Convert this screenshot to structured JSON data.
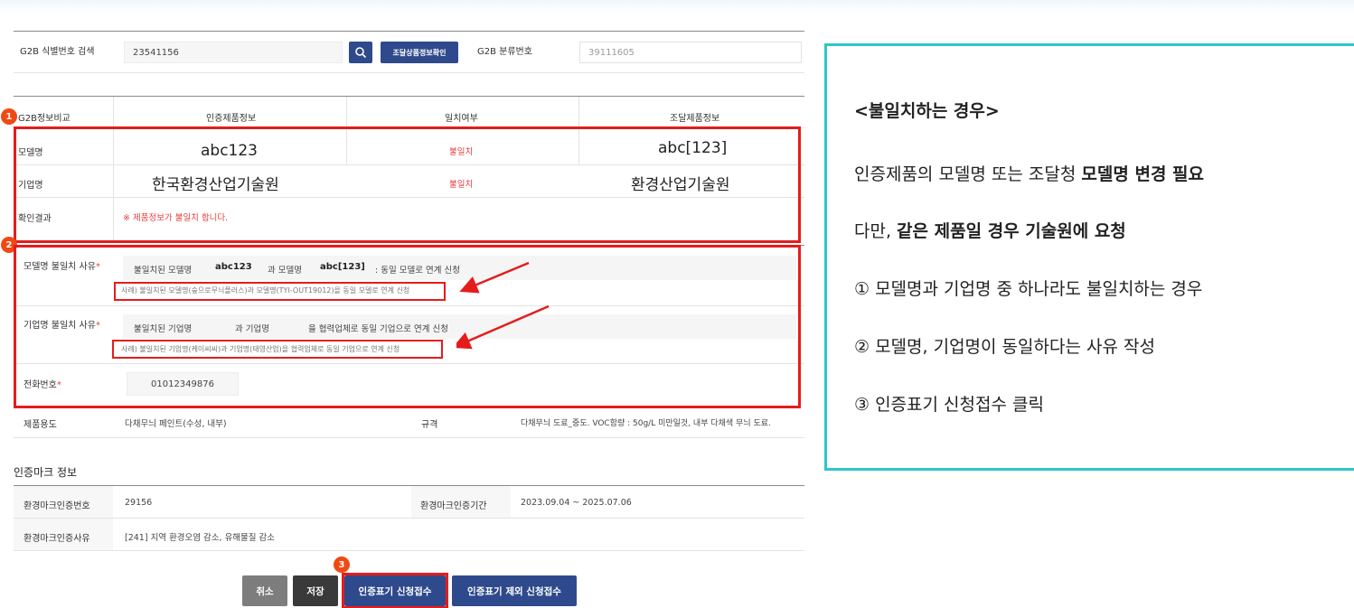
{
  "search": {
    "label": "G2B 식별번호 검색",
    "value": "23541156",
    "confirm_button": "조달상품정보확인",
    "class_label": "G2B 분류번호",
    "class_value": "39111605"
  },
  "compare": {
    "headers": [
      "G2B정보비교",
      "인증제품정보",
      "일치여부",
      "조달제품정보"
    ],
    "rows": [
      {
        "label": "모델명",
        "cert": "abc123",
        "match": "불일치",
        "procure": "abc[123]"
      },
      {
        "label": "기업명",
        "cert": "한국환경산업기술원",
        "match": "불일치",
        "procure": "환경산업기술원"
      }
    ],
    "result_label": "확인결과",
    "result_text": "※ 제품정보가 불일치 합니다."
  },
  "reasons": {
    "model_label": "모델명 불일치 사유",
    "model_prefix": "불일치된 모델명",
    "model_cert": "abc123",
    "model_mid": "과 모델명",
    "model_procure": "abc[123]",
    "model_suffix": ": 동일 모델로 연계 신청",
    "model_hint": "사례) 불일치된 모델명(숲으로무늬플러스)과 모델명(TYI-OUT19012)을 동일 모델로 연계 신청",
    "company_label": "기업명 불일치 사유",
    "company_prefix": "불일치된 기업명",
    "company_mid": "과 기업명",
    "company_suffix": "을 협력업체로 동일 기업으로 연계 신청",
    "company_hint": "사례) 불일치된 기업명(케이씨씨)과 기업명(태영산업)을 협력업체로 동일 기업으로 연계 신청",
    "phone_label": "전화번호",
    "phone_value": "01012349876",
    "required_mark": "*"
  },
  "usage": {
    "label": "제품용도",
    "value": "다채무늬 페인트(수성, 내부)",
    "spec_label": "규격",
    "spec_value": "다채무늬 도료_중도. VOC함량 : 50g/L 미만일것, 내부 다채색 무늬 도료."
  },
  "mark": {
    "section_title": "인증마크 정보",
    "number_label": "환경마크인증번호",
    "number_value": "29156",
    "period_label": "환경마크인증기간",
    "period_value": "2023.09.04 ~ 2025.07.06",
    "reason_label": "환경마크인증사유",
    "reason_value": "[241] 지역 환경오염 감소, 유해물질 감소"
  },
  "buttons": {
    "cancel": "취소",
    "save": "저장",
    "apply": "인증표기 신청접수",
    "exclude": "인증표기 제외 신청접수"
  },
  "badges": [
    "1",
    "2",
    "3"
  ],
  "callout": {
    "title": "<불일치하는 경우>",
    "line1_plain": "인증제품의 모델명 또는 조달청 ",
    "line1_bold": "모델명 변경 필요",
    "line2_plain": "다만, ",
    "line2_bold1": "같은 제품",
    "line2_mid": "일 경우 ",
    "line2_bold2": "기술원",
    "line2_end": "에 요청",
    "step1": "① 모델명과 기업명 중 하나라도 불일치하는 경우",
    "step2": "② 모델명, 기업명이 동일하다는 사유 작성",
    "step3": "③ 인증표기 신청접수 클릭"
  },
  "colors": {
    "navy": "#2e4a8c",
    "dark_button": "#3a3a3a",
    "gray_button": "#7d7d7d",
    "highlight_red": "#e51c1c",
    "badge_orange": "#f04a14",
    "callout_border": "#2ec7c7",
    "mismatch_red": "#e84040"
  },
  "icons": [
    "search-icon",
    "arrow-icon"
  ]
}
